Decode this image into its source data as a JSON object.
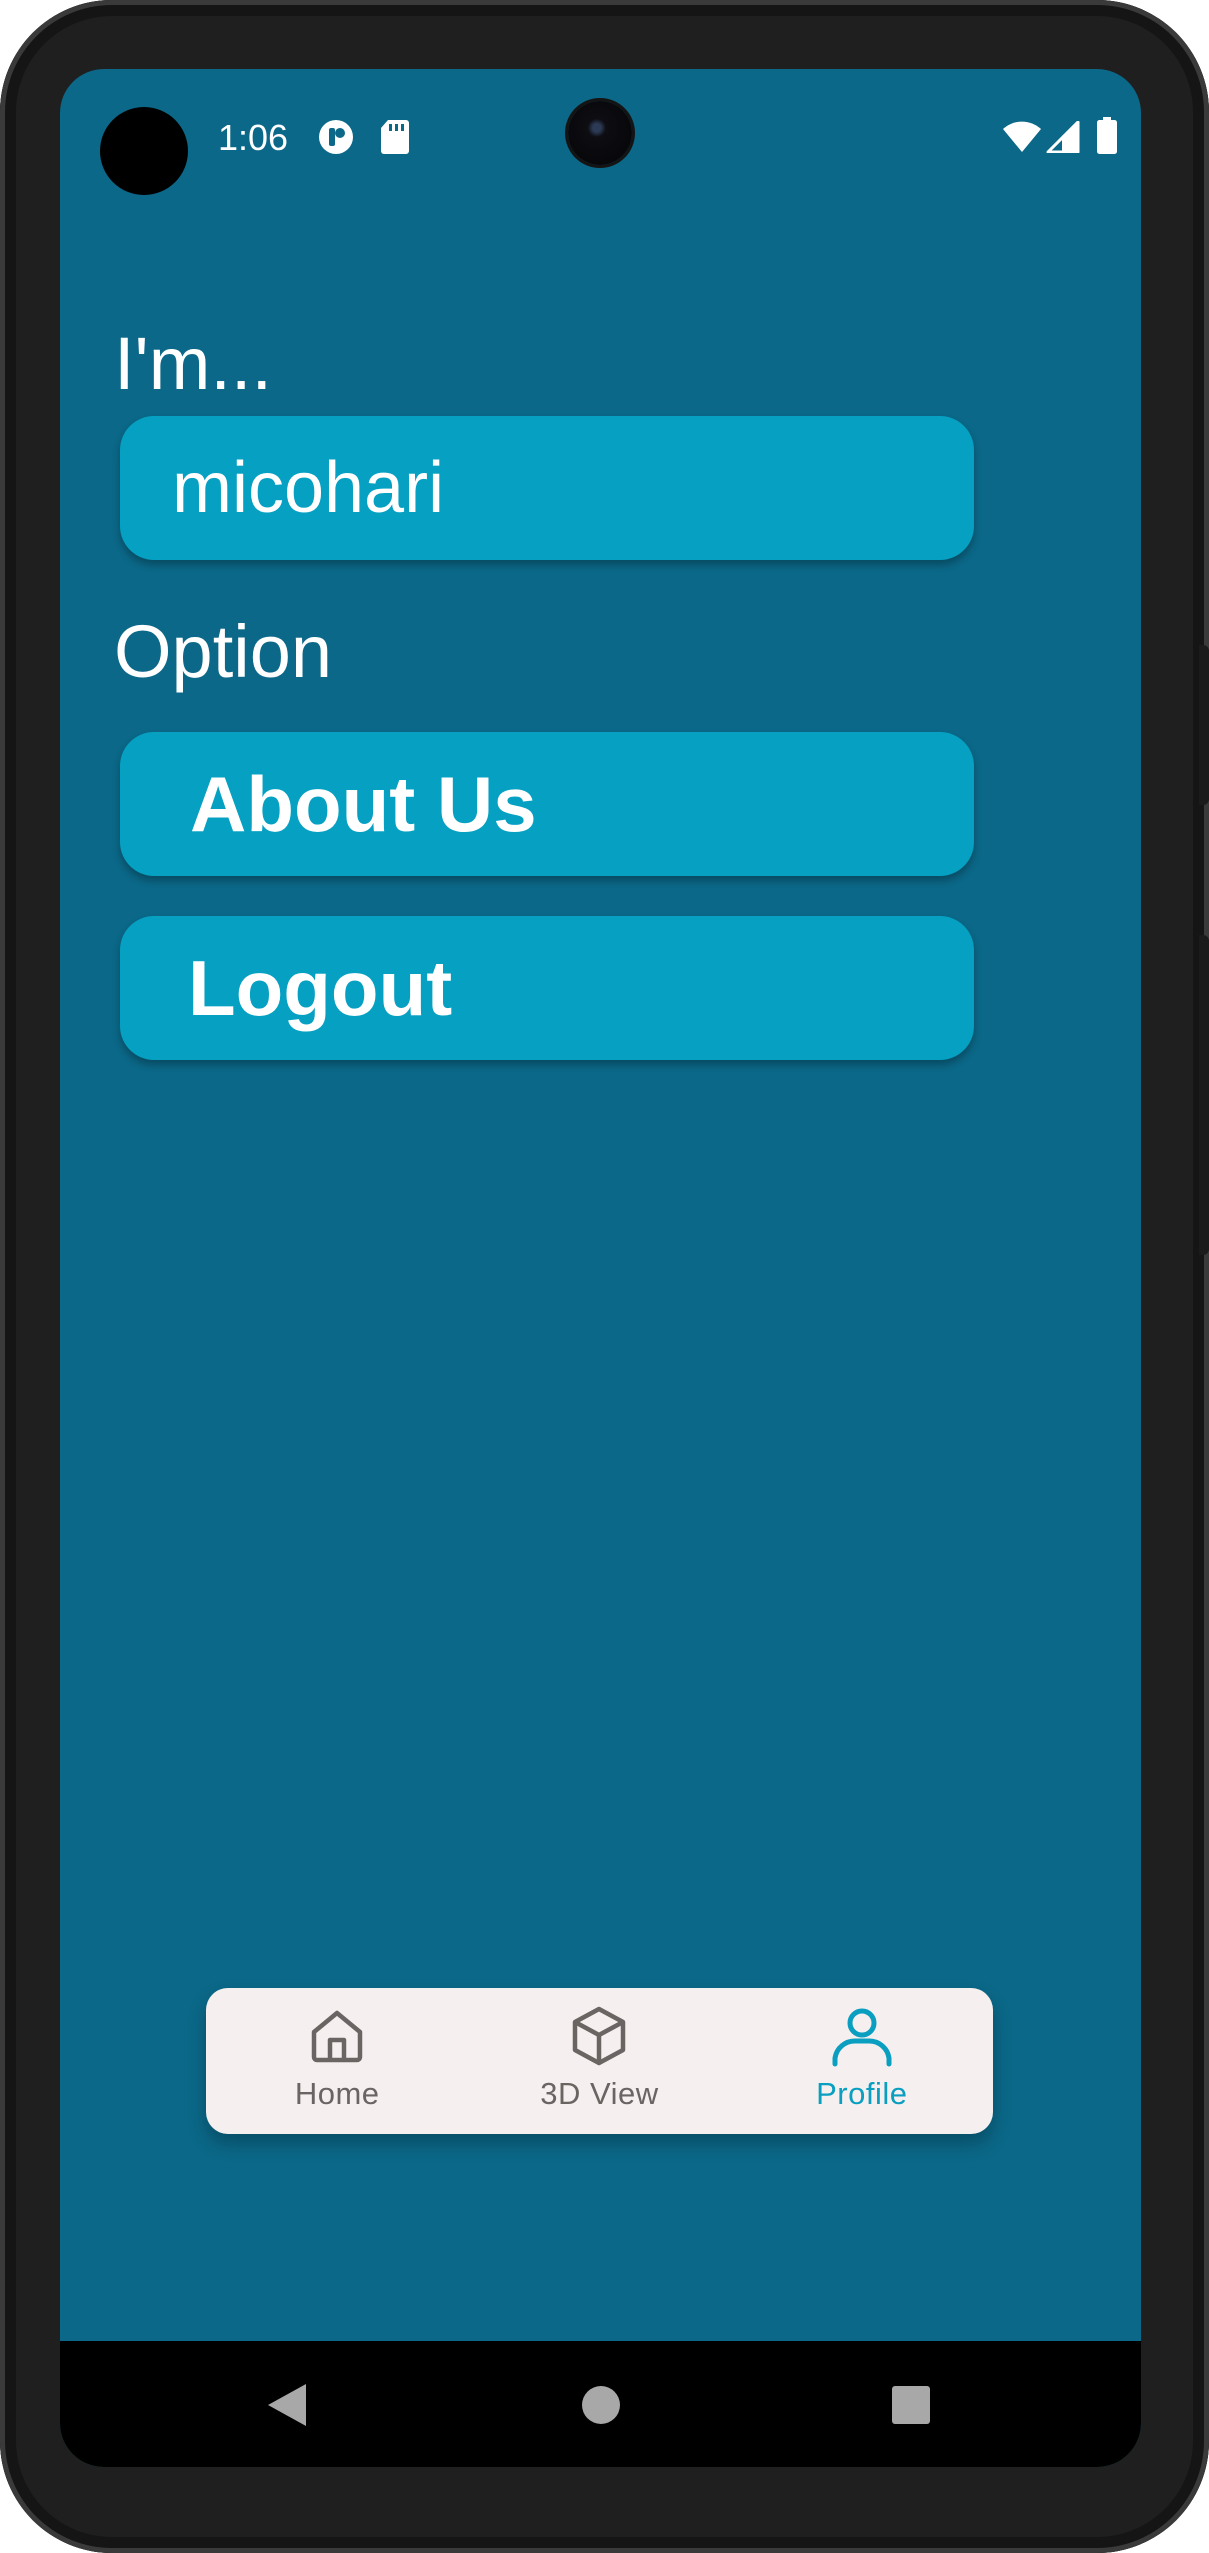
{
  "status_bar": {
    "time": "1:06",
    "icons": [
      "app-notification-icon",
      "sd-card-icon",
      "wifi-icon",
      "cell-signal-icon",
      "battery-icon"
    ]
  },
  "profile": {
    "identity_label": "I'm...",
    "username": "micohari",
    "options_label": "Option",
    "about_button": "About Us",
    "logout_button": "Logout"
  },
  "bottom_nav": {
    "items": [
      {
        "label": "Home",
        "icon": "home-icon",
        "active": false
      },
      {
        "label": "3D View",
        "icon": "cube-icon",
        "active": false
      },
      {
        "label": "Profile",
        "icon": "person-icon",
        "active": true
      }
    ]
  },
  "system_nav": {
    "buttons": [
      "back-icon",
      "home-circle-icon",
      "recents-icon"
    ]
  },
  "colors": {
    "background": "#0b6888",
    "card": "#05a0c2",
    "nav_background": "#f5f0ef",
    "nav_active": "#0a9ec0",
    "nav_inactive": "#6a6463"
  }
}
